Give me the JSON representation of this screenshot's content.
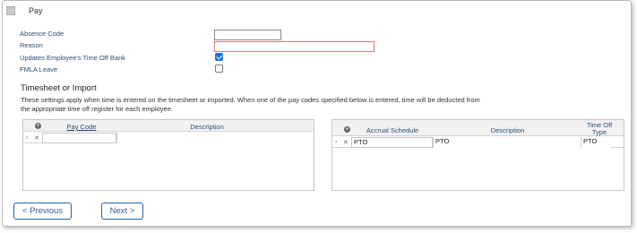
{
  "header": {
    "title": "Pay",
    "icon": "window-icon"
  },
  "form": {
    "absence_code_label": "Absence Code",
    "absence_code_value": "",
    "reason_label": "Reason",
    "reason_value": "",
    "updates_bank_label": "Updates Employee's Time Off Bank",
    "updates_bank_checked": true,
    "fmla_label": "FMLA Leave",
    "fmla_checked": false
  },
  "section": {
    "title": "Timesheet or Import",
    "description": "These settings apply when time is entered on the timesheet or imported. When one of the pay codes specified below is entered, time will be deducted from the appropriate time off register for each employee."
  },
  "pay_code_grid": {
    "columns": [
      "Pay Code",
      "Description"
    ],
    "rows": [
      {
        "pay_code": "",
        "description": ""
      }
    ]
  },
  "accrual_grid": {
    "columns": [
      "Accrual Schedule",
      "Description",
      "Time Off",
      "Type"
    ],
    "rows": [
      {
        "schedule": "PTO",
        "description": "PTO",
        "type": "PTO"
      }
    ]
  },
  "buttons": {
    "previous": "< Previous",
    "next": "Next >"
  },
  "colors": {
    "accent": "#2b5ea7",
    "label": "#2a4f7a",
    "checkbox": "#1a73e8",
    "required_border": "#d77a7a"
  }
}
